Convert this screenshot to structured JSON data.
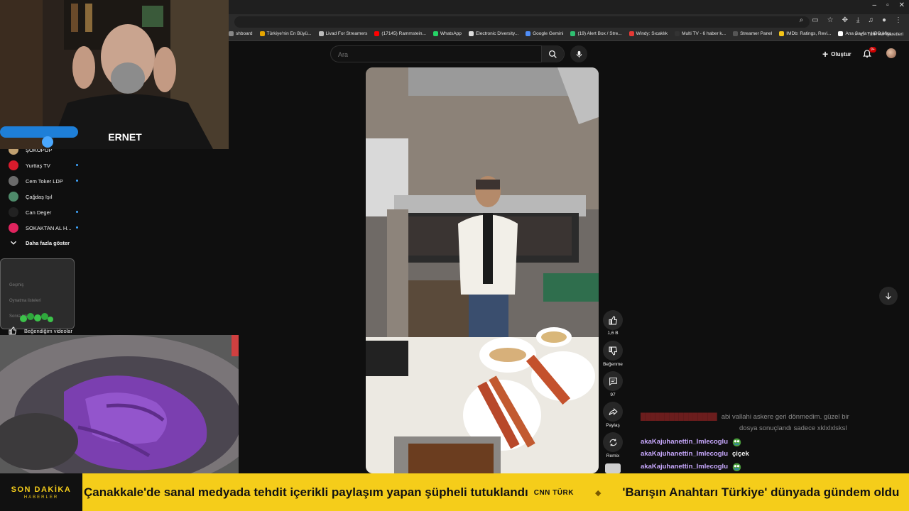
{
  "browser": {
    "bookmarks": [
      {
        "label": "shboard",
        "color": "#888888"
      },
      {
        "label": "Türkiye'nin En Büyü...",
        "color": "#e6a500"
      },
      {
        "label": "Livad For Streamers",
        "color": "#bbbbbb"
      },
      {
        "label": "(17145) Rammstein...",
        "color": "#ff0000"
      },
      {
        "label": "WhatsApp",
        "color": "#25d366"
      },
      {
        "label": "Electronic Diversity...",
        "color": "#dddddd"
      },
      {
        "label": "Google Gemini",
        "color": "#4f8df7"
      },
      {
        "label": "(19) Alert Box / Stre...",
        "color": "#2fbf71"
      },
      {
        "label": "Windy: Sıcaklık",
        "color": "#e53935"
      },
      {
        "label": "Multi TV - 6 haber k...",
        "color": "#333333"
      },
      {
        "label": "Streamer Panel",
        "color": "#555555"
      },
      {
        "label": "IMDb: Ratings, Revi...",
        "color": "#f5c518"
      },
      {
        "label": "Ana Sayfa • HBO Max",
        "color": "#ffffff"
      }
    ],
    "all_bookmarks_label": "Tüm Yer İşaretleri"
  },
  "header": {
    "search_placeholder": "Ara",
    "create_label": "Oluştur",
    "notification_badge": "9+"
  },
  "sidebar": {
    "items": [
      {
        "label": "ŞOKOPOP",
        "live": false,
        "color": "#c0a070"
      },
      {
        "label": "Yurttaş TV",
        "live": true,
        "color": "#d81b2c"
      },
      {
        "label": "Cem Toker LDP",
        "live": true,
        "color": "#6b6b6b"
      },
      {
        "label": "Çağdaş Işıl",
        "live": false,
        "color": "#4e8a6a"
      },
      {
        "label": "Can Deger",
        "live": true,
        "color": "#222222"
      },
      {
        "label": "SOKAKTAN AL H...",
        "live": true,
        "color": "#e0245e"
      }
    ],
    "show_more_label": "Daha fazla göster",
    "ghost_items": [
      "Geçmiş",
      "Oynatma listeleri",
      "Sonra izle"
    ],
    "liked_label": "Beğendiğim videolar"
  },
  "short_actions": {
    "like_count": "1,6 B",
    "dislike_label": "Beğenme",
    "comment_count": "97",
    "share_label": "Paylaş",
    "remix_label": "Remix"
  },
  "chat": {
    "faded_message_line1": "abi vallahi askere geri dönmedim. güzel bir",
    "faded_message_line2": "dosya sonuçlandı sadece xklxlxlsksl",
    "messages": [
      {
        "user": "akaKajuhanettin_Imlecoglu",
        "text": "",
        "emote": "pepe"
      },
      {
        "user": "akaKajuhanettin_Imlecoglu",
        "text": "çiçek",
        "emote": ""
      },
      {
        "user": "akaKajuhanettin_Imlecoglu",
        "text": "",
        "emote": "pepe"
      }
    ]
  },
  "ticker": {
    "logo_main": "SON DAKİKA",
    "logo_sub": "HABERLER",
    "headline_1": "Çanakkale'de sanal medyada tehdit içerikli paylaşım yapan şüpheli tutuklandı",
    "source_1": "CNN TÜRK",
    "headline_2": "'Barışın Anahtarı Türkiye' dünyada gündem oldu"
  },
  "colors": {
    "background": "#0f0f0f",
    "ticker_bg": "#f5cd1a",
    "chat_user": "#c9a9ff",
    "live_dot": "#3ea6ff"
  }
}
